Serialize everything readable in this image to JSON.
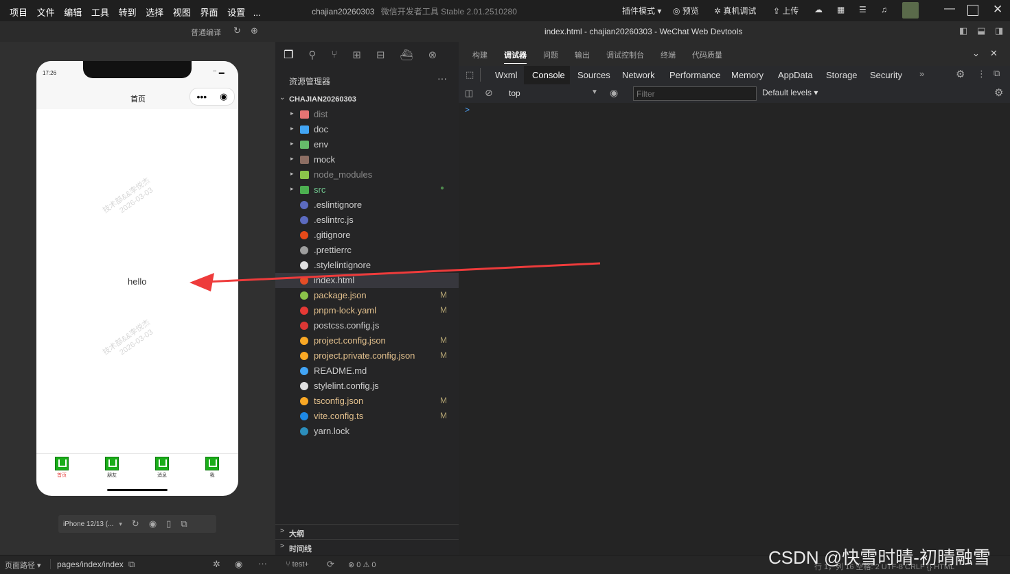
{
  "menu": [
    "项目",
    "文件",
    "编辑",
    "工具",
    "转到",
    "选择",
    "视图",
    "界面",
    "设置",
    "..."
  ],
  "title_project": "chajian20260303",
  "title_app": "微信开发者工具 Stable 2.01.2510280",
  "title_right": {
    "plugin_mode": "插件模式",
    "preview": "预览",
    "real_debug": "真机调试",
    "upload": "上传"
  },
  "sim": {
    "compile_mode": "普通编译",
    "time": "17:26",
    "nav_title": "首页",
    "content": "hello",
    "watermark": "技术部&&李悦杰\n2026-03-03",
    "tabs": [
      "首页",
      "朋友",
      "消息",
      "我"
    ],
    "device": "iPhone 12/13 (..."
  },
  "window_title": "index.html - chajian20260303 - WeChat Web Devtools",
  "top_tabs": [
    "构建",
    "调试器",
    "问题",
    "输出",
    "调试控制台",
    "终端",
    "代码质量"
  ],
  "explorer": {
    "title": "资源管理器",
    "root": "CHAJIAN20260303",
    "items": [
      {
        "name": "dist",
        "folder": true,
        "color": "#e57373",
        "dim": true,
        "status": ""
      },
      {
        "name": "doc",
        "folder": true,
        "color": "#42a5f5",
        "dim": false,
        "status": ""
      },
      {
        "name": "env",
        "folder": true,
        "color": "#66bb6a",
        "dim": false,
        "status": ""
      },
      {
        "name": "mock",
        "folder": true,
        "color": "#8d6e63",
        "dim": false,
        "status": ""
      },
      {
        "name": "node_modules",
        "folder": true,
        "color": "#8bc34a",
        "dim": true,
        "status": ""
      },
      {
        "name": "src",
        "folder": true,
        "color": "#4caf50",
        "dim": false,
        "status": "●",
        "green": true
      },
      {
        "name": ".eslintignore",
        "folder": false,
        "color": "#5c6bc0",
        "dim": false,
        "status": ""
      },
      {
        "name": ".eslintrc.js",
        "folder": false,
        "color": "#5c6bc0",
        "dim": false,
        "status": ""
      },
      {
        "name": ".gitignore",
        "folder": false,
        "color": "#e64a19",
        "dim": false,
        "status": ""
      },
      {
        "name": ".prettierrc",
        "folder": false,
        "color": "#9e9e9e",
        "dim": false,
        "status": ""
      },
      {
        "name": ".stylelintignore",
        "folder": false,
        "color": "#e0e0e0",
        "dim": false,
        "status": ""
      },
      {
        "name": "index.html",
        "folder": false,
        "color": "#e44d26",
        "dim": false,
        "status": "",
        "selected": true
      },
      {
        "name": "package.json",
        "folder": false,
        "color": "#8bc34a",
        "dim": false,
        "status": "M",
        "mod": true
      },
      {
        "name": "pnpm-lock.yaml",
        "folder": false,
        "color": "#e53935",
        "dim": false,
        "status": "M",
        "mod": true
      },
      {
        "name": "postcss.config.js",
        "folder": false,
        "color": "#dd3735",
        "dim": false,
        "status": ""
      },
      {
        "name": "project.config.json",
        "folder": false,
        "color": "#f9a825",
        "dim": false,
        "status": "M",
        "mod": true
      },
      {
        "name": "project.private.config.json",
        "folder": false,
        "color": "#f9a825",
        "dim": false,
        "status": "M",
        "mod": true
      },
      {
        "name": "README.md",
        "folder": false,
        "color": "#42a5f5",
        "dim": false,
        "status": ""
      },
      {
        "name": "stylelint.config.js",
        "folder": false,
        "color": "#e0e0e0",
        "dim": false,
        "status": ""
      },
      {
        "name": "tsconfig.json",
        "folder": false,
        "color": "#f9a825",
        "dim": false,
        "status": "M",
        "mod": true
      },
      {
        "name": "vite.config.ts",
        "folder": false,
        "color": "#1e88e5",
        "dim": false,
        "status": "M",
        "mod": true
      },
      {
        "name": "yarn.lock",
        "folder": false,
        "color": "#2c8ebb",
        "dim": false,
        "status": ""
      }
    ],
    "outline": "大纲",
    "timeline": "时间线"
  },
  "devtools_tabs": [
    "Wxml",
    "Console",
    "Sources",
    "Network",
    "Performance",
    "Memory",
    "AppData",
    "Storage",
    "Security"
  ],
  "console": {
    "context": "top",
    "filter_placeholder": "Filter",
    "levels": "Default levels",
    "prompt": ">"
  },
  "bottom": {
    "path_label": "页面路径",
    "path": "pages/index/index",
    "branch": "test+",
    "errors": "0",
    "warnings": "0",
    "status_right": "行 1，列 16   空格: 2   UTF-8   CRLF   {} HTML"
  },
  "csdn_watermark": "CSDN @快雪时晴-初晴融雪"
}
